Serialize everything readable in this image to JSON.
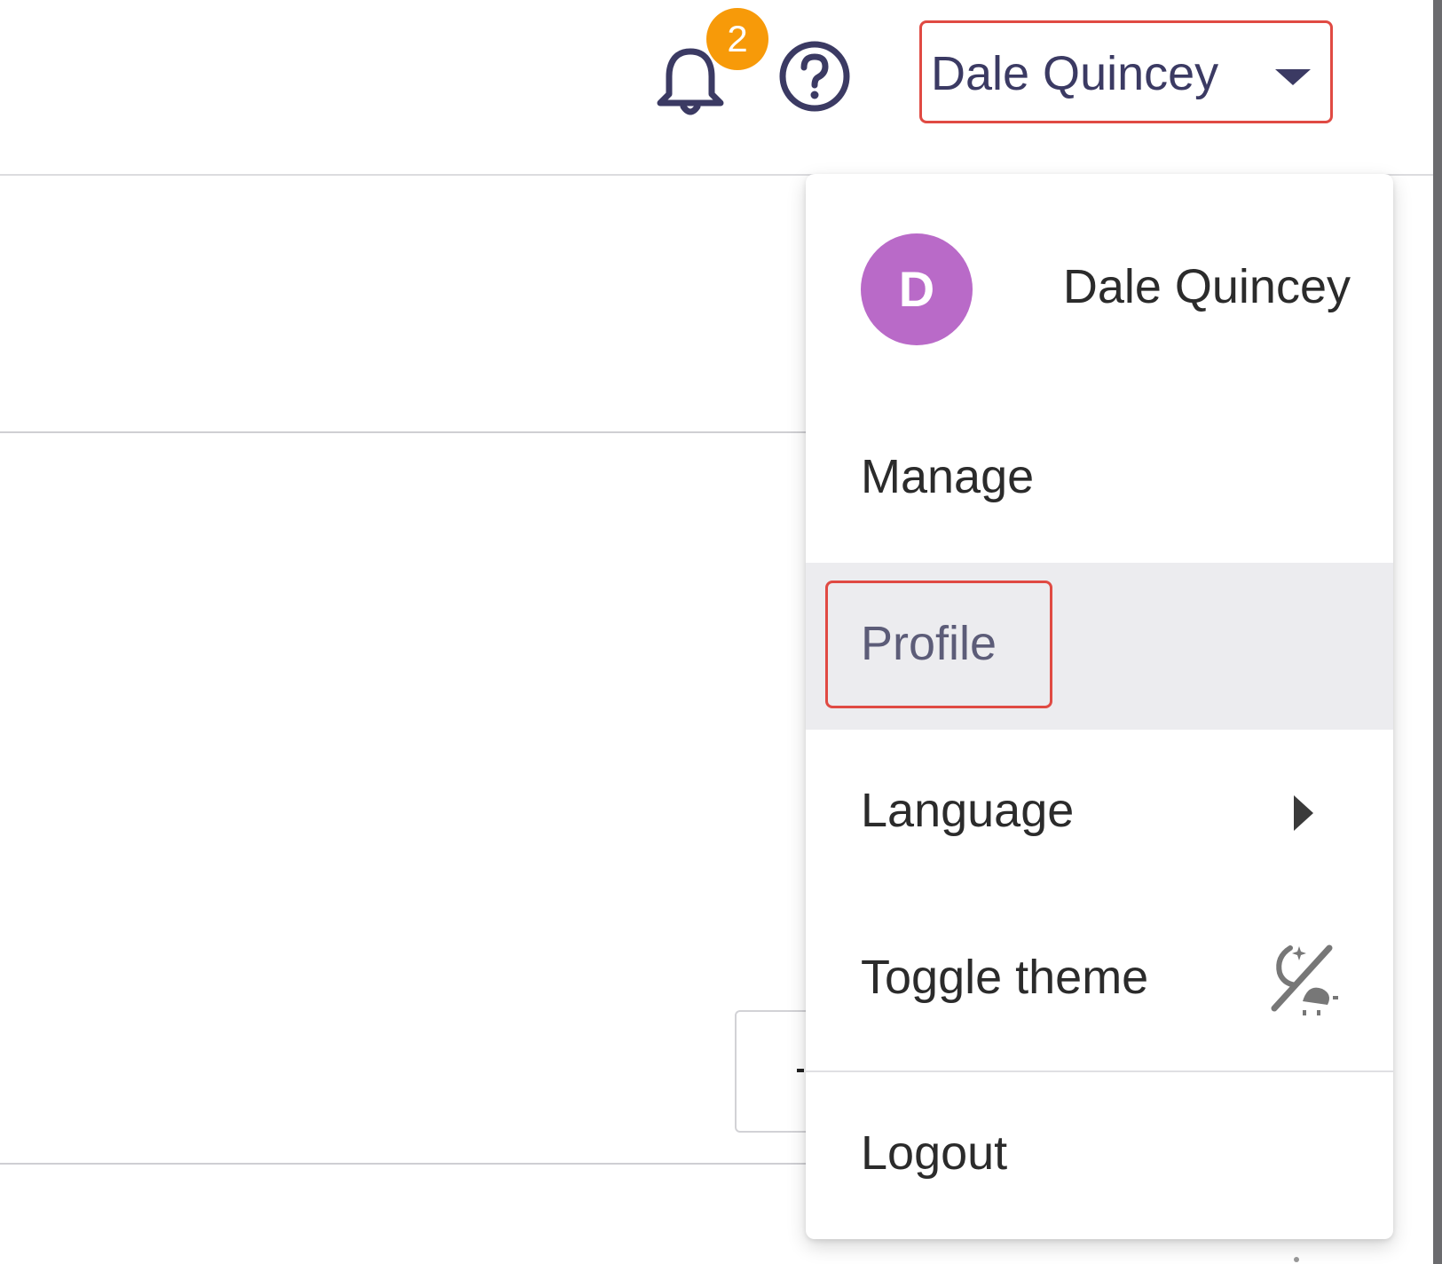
{
  "header": {
    "notifications_icon": "bell-icon",
    "notifications_count": "2",
    "help_icon": "help-circle-icon",
    "user_name": "Dale Quincey",
    "user_menu_icon": "caret-down-icon"
  },
  "user_dropdown": {
    "avatar_initial": "D",
    "avatar_color": "#b96ac8",
    "user_name": "Dale Quincey",
    "items": [
      {
        "label": "Manage"
      },
      {
        "label": "Profile",
        "state": "hovered"
      },
      {
        "label": "Language",
        "icon": "chevron-right-icon"
      },
      {
        "label": "Toggle theme",
        "icon": "theme-toggle-icon"
      },
      {
        "label": "Logout"
      }
    ]
  },
  "colors": {
    "accent_text": "#3b3a63",
    "badge": "#f79a09",
    "highlight_border": "#e04a43",
    "hover_background": "#ececef"
  }
}
